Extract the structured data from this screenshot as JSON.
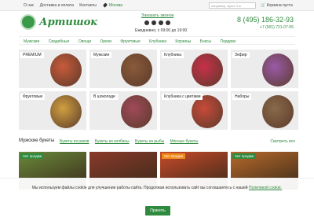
{
  "top": {
    "nav": [
      "О нас",
      "Доставка и оплата",
      "Контакты"
    ],
    "city": "Москва",
    "search_placeholder": "например, букет 3 м.",
    "cart": "Корзина пуста"
  },
  "header": {
    "logo": "Артишок",
    "call": "Заказать звонок",
    "hours": "Ежедневно, с 09:00 до 19:00",
    "phone1": "8 (495) 186-32-93",
    "phone2": "+7 (901) 721-07-55"
  },
  "menu": [
    "Мужские",
    "Свадебные",
    "Овощи",
    "Орехи",
    "Фруктовые",
    "Клубника",
    "Корзины",
    "Боксы",
    "Подарки"
  ],
  "categories": [
    {
      "label": "PREMIUM",
      "color": "#c85a3a"
    },
    {
      "label": "Мужские",
      "color": "#8a5a3a"
    },
    {
      "label": "Клубника",
      "color": "#c8304a"
    },
    {
      "label": "Зефир",
      "color": "#9a5aa8"
    },
    {
      "label": "Фруктовые",
      "color": "#d0a040"
    },
    {
      "label": "В шоколаде",
      "color": "#a04a5a"
    },
    {
      "label": "Клубника с цветами",
      "color": "#c84a3a"
    },
    {
      "label": "Наборы",
      "color": "#8a6a4a"
    }
  ],
  "section": {
    "title": "Мужские букеты",
    "tabs": [
      "Букеты из раков",
      "Букеты из колбасы",
      "Букеты из рыбы",
      "Мясные букеты"
    ],
    "all": "Смотреть все"
  },
  "products": [
    {
      "badge": "Хит продаж",
      "badge_type": "green",
      "color": "#6a8a3a"
    },
    {
      "badge": "",
      "badge_type": "",
      "color": "#8a3a2a"
    },
    {
      "badge": "Хит продаж",
      "badge_type": "orange",
      "color": "#c84a2a"
    },
    {
      "badge": "Хит продаж",
      "badge_type": "green",
      "color": "#b86a2a"
    }
  ],
  "cookie": {
    "text": "Мы используем файлы cookie для улучшения работы сайта. Продолжая использовать сайт вы соглашаетесь с нашей",
    "link": "Политикой cookie.",
    "accept": "Принять"
  }
}
